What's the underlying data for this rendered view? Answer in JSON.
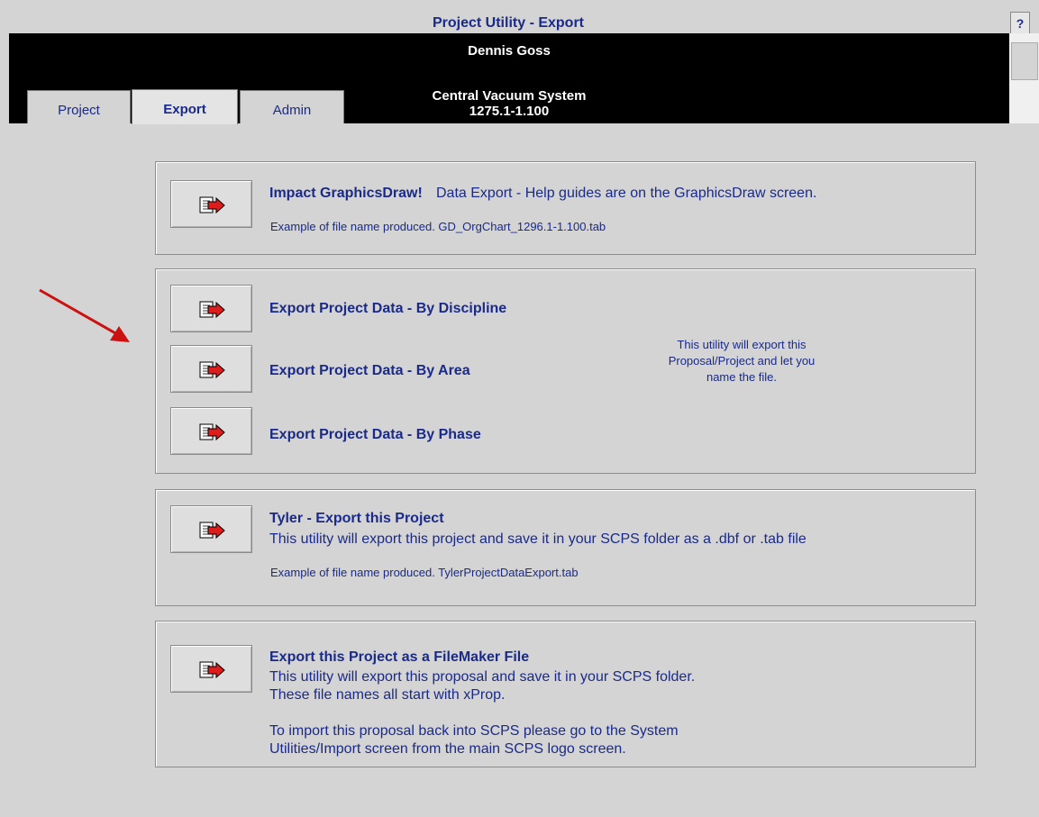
{
  "window": {
    "title": "Project Utility - Export",
    "help_label": "?",
    "user_name": "Dennis Goss",
    "project_name": "Central Vacuum System",
    "project_number": "1275.1-1.100"
  },
  "tabs": [
    {
      "label": "Project",
      "active": false
    },
    {
      "label": "Export",
      "active": true
    },
    {
      "label": "Admin",
      "active": false
    }
  ],
  "graphicsdraw": {
    "title": "Impact GraphicsDraw!",
    "desc": "Data Export - Help guides are on the GraphicsDraw screen.",
    "example": "Example of file name produced. GD_OrgChart_1296.1-1.100.tab"
  },
  "project_export": {
    "discipline_label": "Export Project Data - By Discipline",
    "area_label": "Export Project Data - By Area",
    "phase_label": "Export Project Data - By Phase",
    "note": "This utility will export this Proposal/Project and let you name the file."
  },
  "tyler": {
    "title": "Tyler - Export this Project",
    "desc": "This utility will export this project and save it in your SCPS folder as a .dbf or .tab file",
    "example": "Example of file name produced. TylerProjectDataExport.tab"
  },
  "filemaker": {
    "title": "Export this Project as a FileMaker File",
    "desc": "This utility will export this proposal and save it in your SCPS folder.\nThese file names all start with xProp.\n\nTo import this proposal back into SCPS please go to the System\nUtilities/Import screen from the main SCPS logo screen."
  },
  "colors": {
    "text": "#1a2a8a",
    "background": "#d4d4d4",
    "arrow": "#cc1111"
  }
}
